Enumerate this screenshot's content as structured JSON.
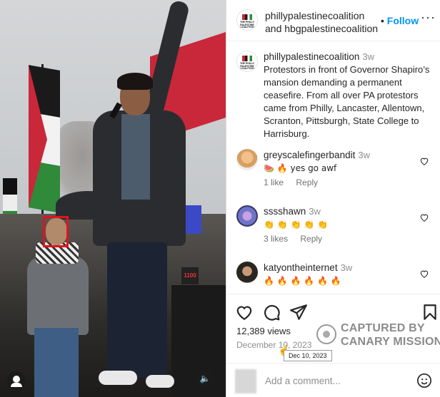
{
  "post": {
    "author": "phillypalestinecoalition",
    "coauthor_line": "and hbgpalestinecoalition",
    "follow_label": "Follow",
    "more_label": "···",
    "logo_text": "THE PHILLY PALESTINE COALITION",
    "caption_author": "phillypalestinecoalition",
    "caption_age": "3w",
    "caption": "Protestors in front of Governor Shapiro’s mansion demanding a permanent ceasefire. From all over PA protestors came from Philly, Lancaster, Allentown, Scranton, Pittsburgh, State College to Harrisburg."
  },
  "comments": [
    {
      "user": "greyscalefingerbandit",
      "age": "3w",
      "text": "🍉 🔥 yes go awf",
      "likes": "1 like",
      "reply": "Reply"
    },
    {
      "user": "sssshawn",
      "age": "3w",
      "text": "👏 👏 👏 👏 👏",
      "likes": "3 likes",
      "reply": "Reply"
    },
    {
      "user": "katyontheinternet",
      "age": "3w",
      "text": "🔥 🔥 🔥 🔥 🔥 🔥",
      "likes": "",
      "reply": ""
    }
  ],
  "stats": {
    "views": "12,389 views",
    "date": "December 10, 2023",
    "tooltip": "Dec 10, 2023"
  },
  "watermark": {
    "line1": "CAPTURED BY",
    "line2": "CANARY MISSION"
  },
  "comment_box": {
    "placeholder": "Add a comment..."
  },
  "media": {
    "sign_text": "1100"
  },
  "icons": {
    "like": "heart-icon",
    "comment": "comment-icon",
    "share": "share-icon",
    "save": "bookmark-icon",
    "emoji": "emoji-icon",
    "sound": "speaker-icon",
    "tagged": "person-icon"
  },
  "colors": {
    "accent": "#0095f6",
    "highlight_box": "#e0141c"
  }
}
